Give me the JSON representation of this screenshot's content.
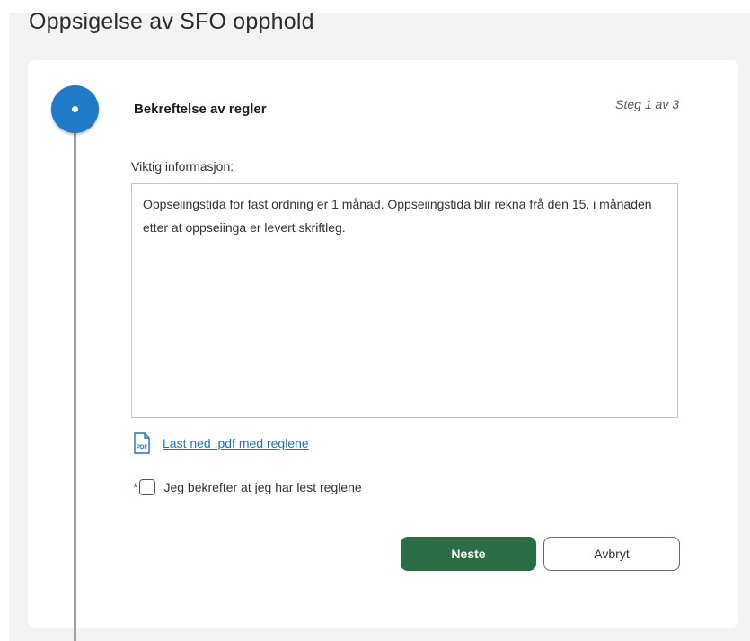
{
  "page": {
    "title": "Oppsigelse av SFO opphold"
  },
  "step": {
    "title": "Bekreftelse av regler",
    "counter": "Steg 1 av 3",
    "icon": "step-active-dot-icon"
  },
  "info": {
    "label": "Viktig informasjon:",
    "text": "Oppseiingstida for fast ordning er 1 månad. Oppseiingstida blir rekna frå den 15. i månaden etter at oppseiinga er levert skriftleg."
  },
  "download": {
    "icon": "pdf-icon",
    "icon_text": "PDF",
    "label": "Last ned .pdf med reglene"
  },
  "confirm": {
    "required_mark": "*",
    "label": "Jeg bekrefter at jeg har lest reglene",
    "checked": false
  },
  "actions": {
    "next_label": "Neste",
    "cancel_label": "Avbryt"
  },
  "colors": {
    "step_active": "#1f7ac7",
    "primary_button": "#2b6e45",
    "link": "#1f73b7",
    "required": "#c0262d"
  }
}
